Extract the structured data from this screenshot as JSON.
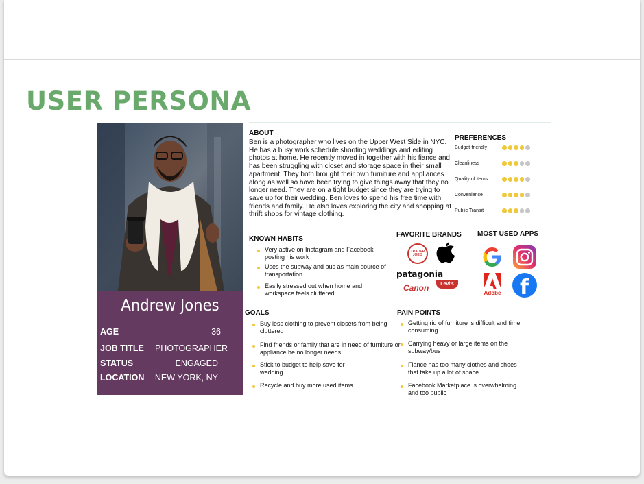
{
  "slide": {
    "title": "USER PERSONA"
  },
  "persona": {
    "name": "Andrew Jones",
    "fields": [
      {
        "label": "AGE",
        "value": "36"
      },
      {
        "label": "JOB TITLE",
        "value": "PHOTOGRAPHER"
      },
      {
        "label": "STATUS",
        "value": "ENGAGED"
      },
      {
        "label": "LOCATION",
        "value": "NEW YORK, NY"
      }
    ]
  },
  "about": {
    "heading": "ABOUT",
    "text": "Ben is a photographer who lives on the Upper West Side in NYC. He has a busy work schedule shooting weddings and editing photos at home. He recently moved in together with his fiance and has been struggling with closet and storage space in their small apartment. They both brought their own furniture and appliances along as well so have been trying to give things away that they no longer need. They are on a tight budget since they are trying to save up for their wedding. Ben loves to spend his free time with friends and family. He also loves exploring the city and shopping at thrift shops for vintage clothing."
  },
  "preferences": {
    "heading": "PREFERENCES",
    "items": [
      {
        "label": "Budget-friendly",
        "rating": 4,
        "max": 5
      },
      {
        "label": "Cleanliness",
        "rating": 3,
        "max": 5
      },
      {
        "label": "Quality of items",
        "rating": 4,
        "max": 5
      },
      {
        "label": "Convenience",
        "rating": 4,
        "max": 5
      },
      {
        "label": "Public Transit",
        "rating": 3,
        "max": 5
      }
    ]
  },
  "habits": {
    "heading": "KNOWN HABITS",
    "items": [
      "Very active on Instagram and Facebook posting his work",
      "Uses the subway and bus as main source of transportation",
      "Easily stressed out when home and workspace feels cluttered"
    ]
  },
  "brands": {
    "heading": "FAVORITE BRANDS",
    "items": [
      "TRADER JOE'S",
      "patagonia",
      "Levi's",
      "Canon"
    ],
    "icons": [
      "apple-logo"
    ]
  },
  "apps": {
    "heading": "MOST USED APPS",
    "items": [
      "google-logo",
      "instagram-logo",
      "adobe-logo",
      "facebook-logo"
    ],
    "adobe_label": "Adobe",
    "google_letter": "G",
    "facebook_letter": "f"
  },
  "goals": {
    "heading": "GOALS",
    "items": [
      "Buy less clothing to prevent closets from being cluttered",
      "Find friends or family that are in need of furniture or appliance he no longer needs",
      "Stick to budget to help save for wedding",
      "Recycle and buy more used items"
    ]
  },
  "pain_points": {
    "heading": "PAIN POINTS",
    "items": [
      "Getting rid of furniture is difficult and time consuming",
      "Carrying heavy or large items on the subway/bus",
      "Fiance has too many clothes and shoes that take up a lot of space",
      "Facebook Marketplace is overwhelming and too public"
    ]
  },
  "colors": {
    "title_green": "#6aa96c",
    "card_purple": "#653a60",
    "dot_yellow": "#f0c93a",
    "dot_gray": "#c7c7c7"
  }
}
